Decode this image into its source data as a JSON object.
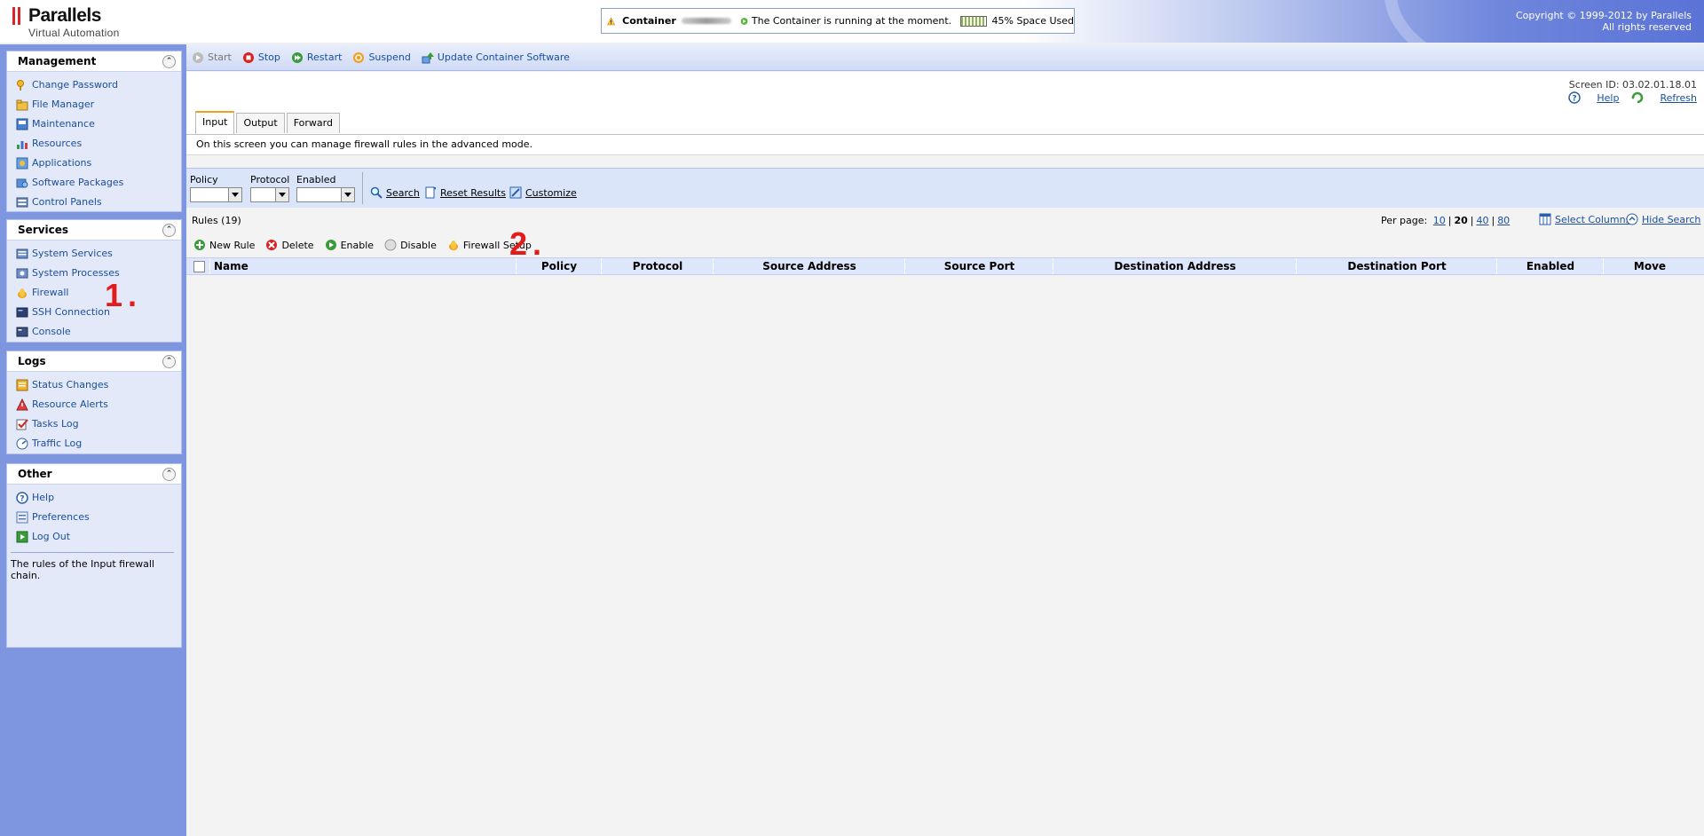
{
  "header": {
    "logo_name": "Parallels",
    "logo_sub": "Virtual Automation",
    "container_label": "Container",
    "status_text": "The Container is running at the moment.",
    "space_used": "45% Space Used",
    "copyright_line1": "Copyright © 1999-2012 by Parallels",
    "copyright_line2": "All rights reserved"
  },
  "sidebar": {
    "management": {
      "title": "Management",
      "items": [
        "Change Password",
        "File Manager",
        "Maintenance",
        "Resources",
        "Applications",
        "Software Packages",
        "Control Panels"
      ]
    },
    "services": {
      "title": "Services",
      "items": [
        "System Services",
        "System Processes",
        "Firewall",
        "SSH Connection",
        "Console"
      ]
    },
    "logs": {
      "title": "Logs",
      "items": [
        "Status Changes",
        "Resource Alerts",
        "Tasks Log",
        "Traffic Log"
      ]
    },
    "other": {
      "title": "Other",
      "items": [
        "Help",
        "Preferences",
        "Log Out"
      ],
      "description": "The rules of the Input firewall chain."
    }
  },
  "toolbar": {
    "start": "Start",
    "stop": "Stop",
    "restart": "Restart",
    "suspend": "Suspend",
    "update": "Update Container Software"
  },
  "page": {
    "screen_id": "Screen ID: 03.02.01.18.01",
    "help": "Help",
    "refresh": "Refresh",
    "tabs": [
      "Input",
      "Output",
      "Forward"
    ],
    "info": "On this screen you can manage firewall rules in the advanced mode."
  },
  "search": {
    "policy_label": "Policy",
    "protocol_label": "Protocol",
    "enabled_label": "Enabled",
    "search": "Search",
    "reset": "Reset Results",
    "customize": "Customize"
  },
  "list": {
    "count": "Rules (19)",
    "per_page_label": "Per page:",
    "per_page": [
      "10",
      "20",
      "40",
      "80"
    ],
    "per_page_selected": "20",
    "select_columns": "Select Columns",
    "hide_search": "Hide Search",
    "actions": {
      "new_rule": "New Rule",
      "delete": "Delete",
      "enable": "Enable",
      "disable": "Disable",
      "firewall_setup": "Firewall Setup"
    },
    "columns": [
      "Name",
      "Policy",
      "Protocol",
      "Source Address",
      "Source Port",
      "Destination Address",
      "Destination Port",
      "Enabled",
      "Move"
    ]
  },
  "annotations": [
    "1.",
    "2."
  ],
  "colors": {
    "sidebar_bg": "#7e95e0",
    "link": "#1a4fa0",
    "annotation": "#e31b1b"
  }
}
